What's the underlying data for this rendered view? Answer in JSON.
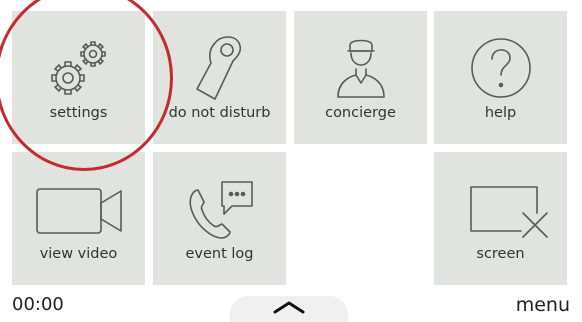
{
  "tiles": [
    {
      "label": "settings",
      "icon": "gears-icon"
    },
    {
      "label": "do not disturb",
      "icon": "door-hanger-icon"
    },
    {
      "label": "concierge",
      "icon": "concierge-icon"
    },
    {
      "label": "help",
      "icon": "question-icon"
    },
    {
      "label": "view video",
      "icon": "video-camera-icon"
    },
    {
      "label": "event log",
      "icon": "phone-message-icon"
    },
    {
      "label": "screen",
      "icon": "screen-off-icon"
    }
  ],
  "footer": {
    "time": "00:00",
    "menu_label": "menu",
    "handle_icon": "chevron-up-icon"
  },
  "colors": {
    "tile_bg": "#e1e3df",
    "highlight": "#c42a30"
  }
}
